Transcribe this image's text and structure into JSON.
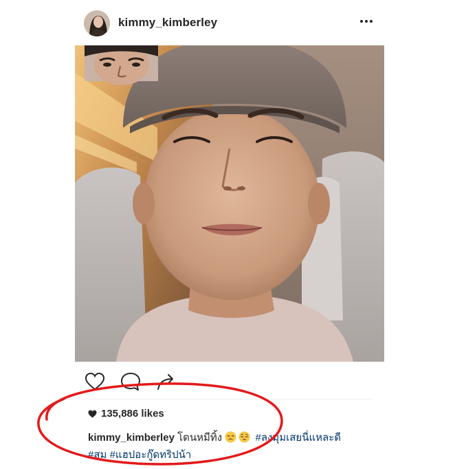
{
  "post": {
    "username": "kimmy_kimberley",
    "likes_label": "135,886 likes",
    "caption": {
      "username": "kimmy_kimberley",
      "text": "โดนหมีทิ้ง",
      "emojis": [
        "unamused-face",
        "pensive-face"
      ],
      "hashtags": [
        "#ลงมุมเสยนี่แหละดี",
        "#สม",
        "#แฮปอะกู๊ดทริปน้า"
      ]
    }
  },
  "icons": {
    "more": "more-dots-icon",
    "like": "heart-outline-icon",
    "comment": "comment-bubble-icon",
    "share": "share-arrow-icon",
    "likes": "heart-filled-icon"
  },
  "colors": {
    "text": "#262626",
    "hashtag": "#003569",
    "annotation": "#e3191b"
  }
}
